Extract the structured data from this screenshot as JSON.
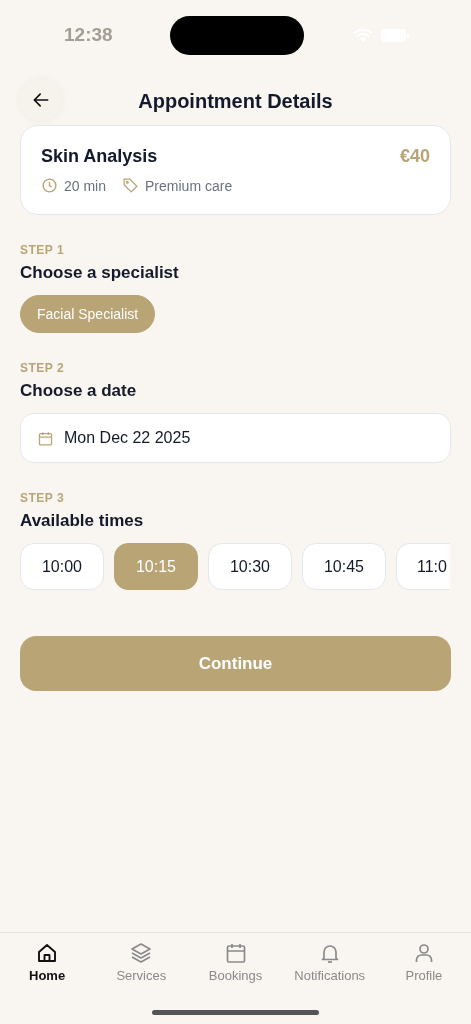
{
  "status_bar": {
    "time": "12:38"
  },
  "header": {
    "title": "Appointment Details"
  },
  "service": {
    "name": "Skin Analysis",
    "price": "€40",
    "duration": "20 min",
    "category": "Premium care"
  },
  "steps": [
    {
      "kind": "specialist",
      "label": "STEP 1",
      "title": "Choose a specialist",
      "options": [
        {
          "label": "Facial Specialist",
          "selected": true
        }
      ]
    },
    {
      "kind": "date",
      "label": "STEP 2",
      "title": "Choose a date",
      "value": "Mon Dec 22 2025"
    },
    {
      "kind": "times",
      "label": "STEP 3",
      "title": "Available times",
      "options": [
        {
          "label": "10:00",
          "selected": false
        },
        {
          "label": "10:15",
          "selected": true
        },
        {
          "label": "10:30",
          "selected": false
        },
        {
          "label": "10:45",
          "selected": false
        },
        {
          "label": "11:0",
          "selected": false
        }
      ]
    }
  ],
  "continue_button": "Continue",
  "tab_bar": [
    {
      "label": "Home",
      "selected": true
    },
    {
      "label": "Services",
      "selected": false
    },
    {
      "label": "Bookings",
      "selected": false
    },
    {
      "label": "Notifications",
      "selected": false
    },
    {
      "label": "Profile",
      "selected": false
    }
  ]
}
